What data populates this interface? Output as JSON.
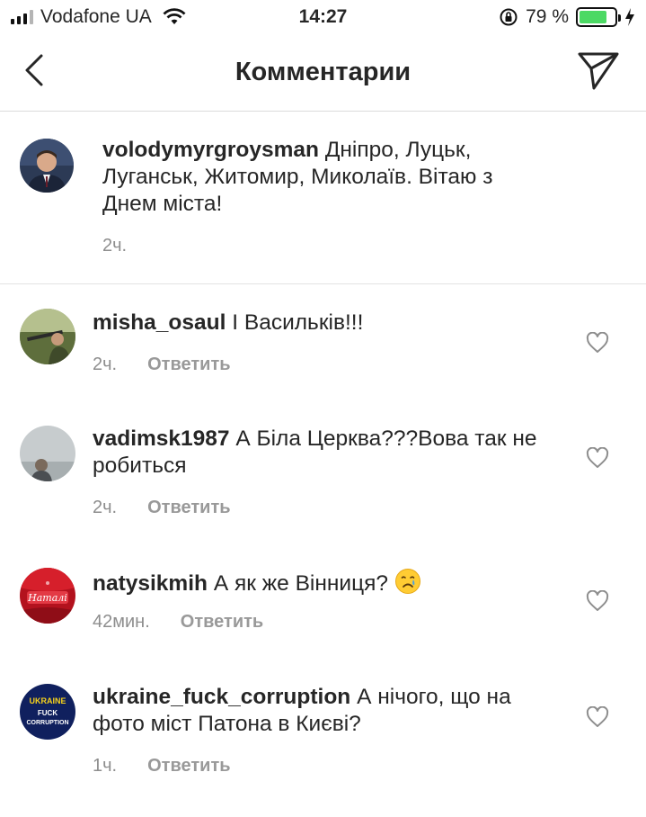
{
  "status_bar": {
    "carrier": "Vodafone UA",
    "time": "14:27",
    "battery_percent": "79 %",
    "battery_level": 0.79,
    "signal_bars": 3
  },
  "header": {
    "title": "Комментарии",
    "back_icon": "chevron-left-icon",
    "send_icon": "direct-send-icon"
  },
  "caption": {
    "username": "volodymyrgroysman",
    "text": "Дніпро, Луцьк, Луганськ, Житомир, Миколаїв. Вітаю з Днем міста!",
    "time": "2ч."
  },
  "comments": [
    {
      "username": "misha_osaul",
      "text": "І Васильків!!!",
      "time": "2ч.",
      "reply_label": "Ответить"
    },
    {
      "username": "vadimsk1987",
      "text": "А Біла Церква???Вова так не робиться",
      "time": "2ч.",
      "reply_label": "Ответить"
    },
    {
      "username": "natysikmih",
      "text": "А як же Вінниця?",
      "emoji": "crying-face",
      "time": "42мин.",
      "reply_label": "Ответить"
    },
    {
      "username": "ukraine_fuck_corruption",
      "text": "А нічого, що на фото міст Патона в Києві?",
      "time": "1ч.",
      "reply_label": "Ответить",
      "avatar_text": [
        "UKRAINE",
        "FUCK",
        "CORRUPTION"
      ]
    }
  ],
  "colors": {
    "text": "#262626",
    "secondary": "#8e8e8e",
    "battery": "#4cd964",
    "divider": "#dbdbdb"
  }
}
